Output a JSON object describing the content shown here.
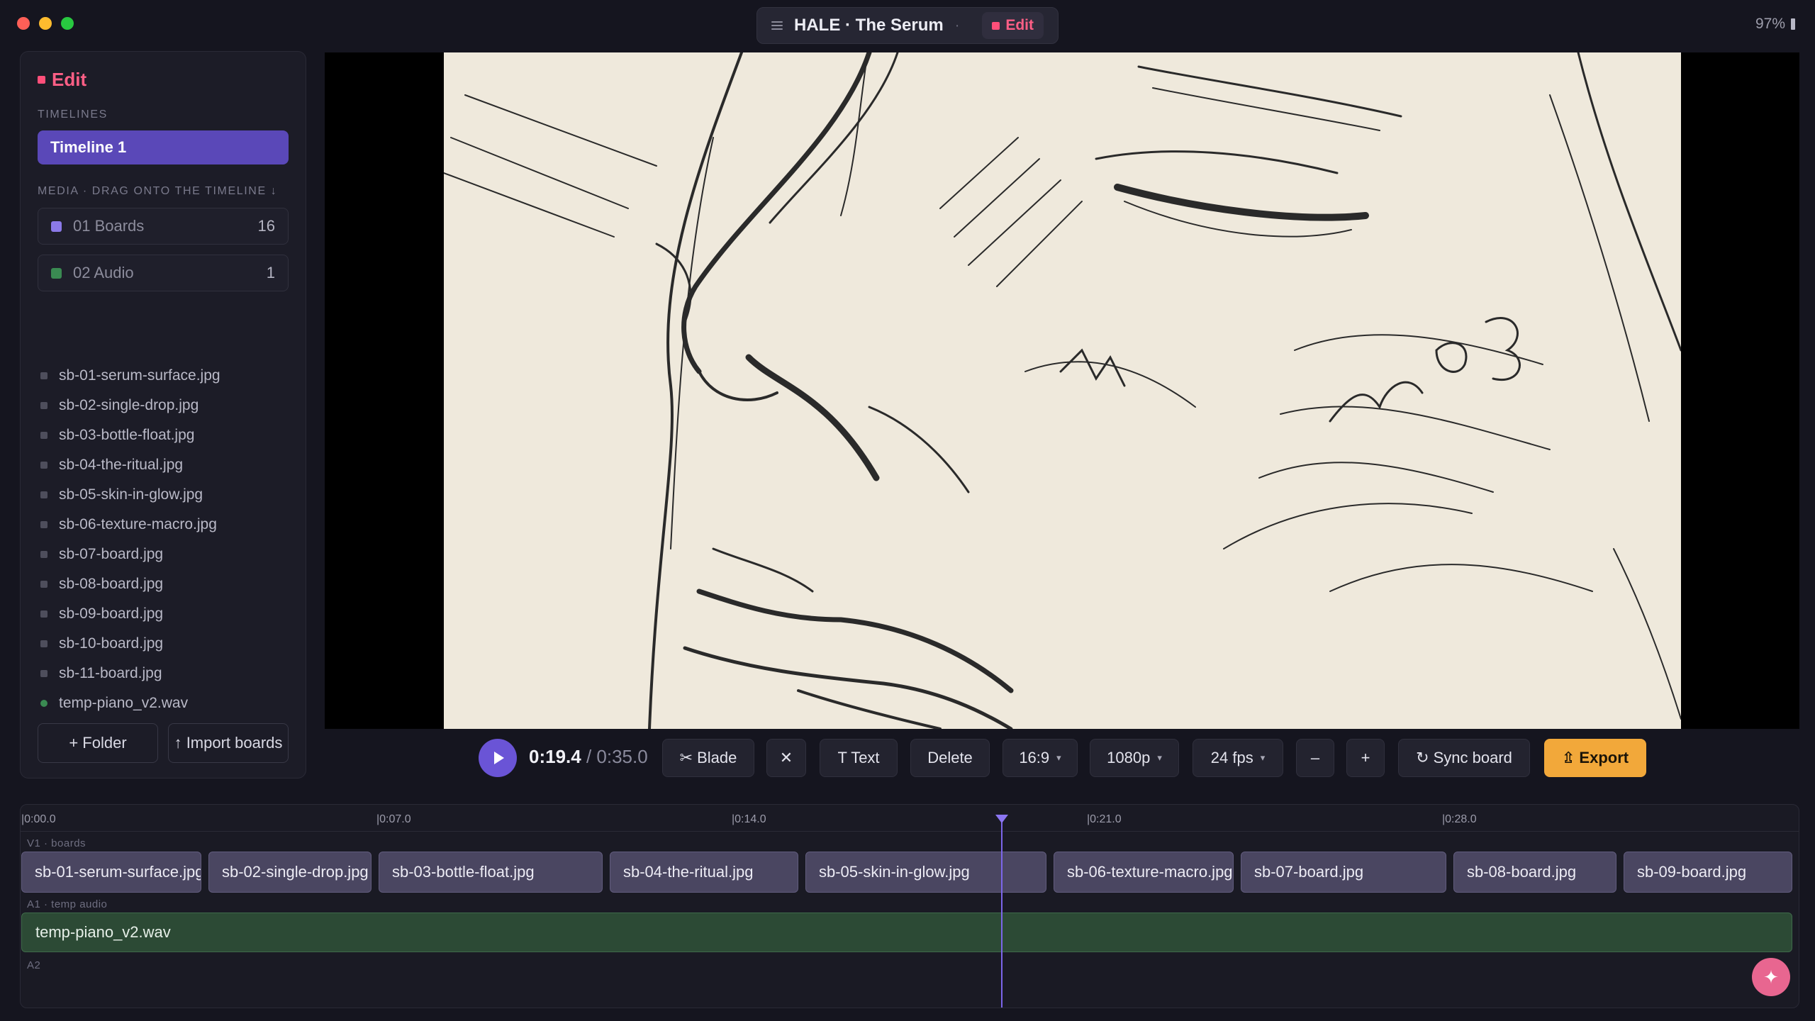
{
  "window": {
    "title": "HALE · The Serum",
    "separator": "·",
    "mode": "Edit",
    "zoom": "97%"
  },
  "colors": {
    "accent": "#5a48b8",
    "edit": "#ff4f7a",
    "export": "#f2a83a",
    "boards": "#8b79e8",
    "audio": "#3a8a52"
  },
  "sidebar": {
    "header": "Edit",
    "timelines_label": "TIMELINES",
    "timelines": [
      {
        "label": "Timeline 1",
        "active": true
      }
    ],
    "media_label": "MEDIA · DRAG ONTO THE TIMELINE ↓",
    "folders": [
      {
        "name": "01 Boards",
        "count": "16"
      },
      {
        "name": "02 Audio",
        "count": "1"
      }
    ],
    "files": [
      "sb-01-serum-surface.jpg",
      "sb-02-single-drop.jpg",
      "sb-03-bottle-float.jpg",
      "sb-04-the-ritual.jpg",
      "sb-05-skin-in-glow.jpg",
      "sb-06-texture-macro.jpg",
      "sb-07-board.jpg",
      "sb-08-board.jpg",
      "sb-09-board.jpg",
      "sb-10-board.jpg",
      "sb-11-board.jpg",
      "temp-piano_v2.wav"
    ],
    "add_folder": "+ Folder",
    "import": "↑ Import boards"
  },
  "transport": {
    "current": "0:19.4",
    "separator": " / ",
    "total": "0:35.0",
    "blade": "✂ Blade",
    "close": "✕",
    "text": "T Text",
    "delete": "Delete",
    "aspect": "16:9",
    "resolution": "1080p",
    "fps": "24 fps",
    "zoom_out": "–",
    "zoom_in": "+",
    "sync": "↻ Sync board",
    "export": "⇫ Export"
  },
  "timeline": {
    "ruler": [
      "|0:00.0",
      "|0:07.0",
      "|0:14.0",
      "|0:21.0",
      "|0:28.0"
    ],
    "tracks": {
      "v1": "V1 · boards",
      "a1": "A1 · temp audio",
      "a2": "A2"
    },
    "v1_clips": [
      "sb-01-serum-surface.jpg",
      "sb-02-single-drop.jpg",
      "sb-03-bottle-float.jpg",
      "sb-04-the-ritual.jpg",
      "sb-05-skin-in-glow.jpg",
      "sb-06-texture-macro.jpg",
      "sb-07-board.jpg",
      "sb-08-board.jpg",
      "sb-09-board.jpg"
    ],
    "a1_clip": "temp-piano_v2.wav",
    "playhead_time": "0:19.4",
    "ai_button": "✦"
  }
}
